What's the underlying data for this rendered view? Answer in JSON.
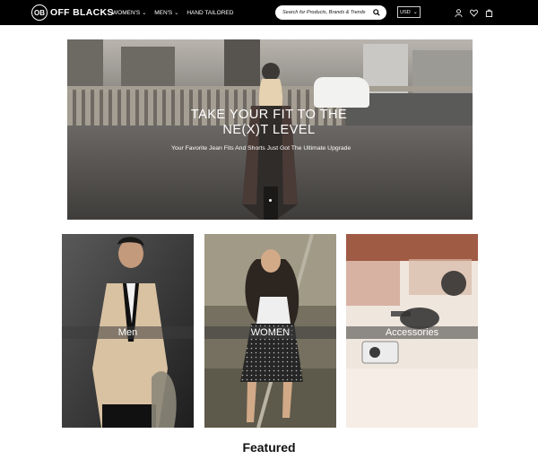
{
  "header": {
    "logo_mark": "OB",
    "logo_text": "OFF BLACKS",
    "nav": [
      {
        "label": "WOMEN'S",
        "has_dropdown": true
      },
      {
        "label": "MEN'S",
        "has_dropdown": true
      },
      {
        "label": "HAND TAILORED",
        "has_dropdown": false
      }
    ],
    "search_placeholder": "Search for Products, Brands & Trends",
    "currency": "USD",
    "icons": [
      "search-icon",
      "user-icon",
      "heart-icon",
      "bag-icon"
    ]
  },
  "hero": {
    "title": "TAKE YOUR FIT TO THE NE(X)T LEVEL",
    "subtitle": "Your Favorite Jean Fits And Shorts Just Got The Ultimate Upgrade"
  },
  "categories": [
    {
      "label": "Men"
    },
    {
      "label": "WOMEN"
    },
    {
      "label": "Accessories"
    }
  ],
  "section_heading": "Featured",
  "colors": {
    "header_bg": "#000000",
    "text": "#111111",
    "overlay": "#3c3c3c"
  }
}
